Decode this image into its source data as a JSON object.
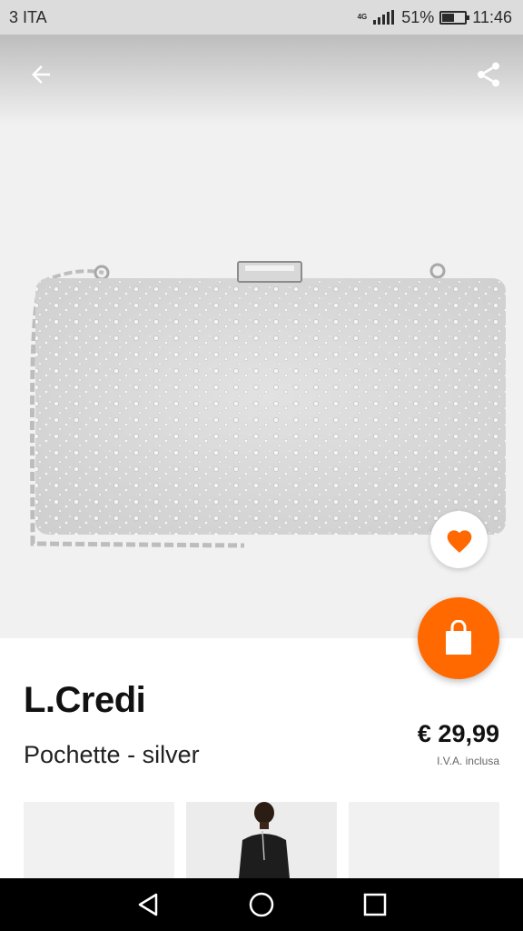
{
  "status_bar": {
    "carrier": "3 ITA",
    "network": "4G",
    "battery_percent": "51%",
    "battery_level": 0.51,
    "time": "11:46"
  },
  "product": {
    "brand": "L.Credi",
    "name": "Pochette - silver",
    "price": "€ 29,99",
    "vat_note": "I.V.A. inclusa"
  },
  "icons": {
    "back": "arrow-left-icon",
    "share": "share-icon",
    "favorite": "heart-icon",
    "cart": "shopping-bag-icon",
    "nav_back": "triangle-back-icon",
    "nav_home": "circle-home-icon",
    "nav_recent": "square-recent-icon"
  },
  "colors": {
    "accent": "#ff6900",
    "status_bar_bg": "#dcdcdc",
    "image_bg": "#f1f1f1"
  }
}
